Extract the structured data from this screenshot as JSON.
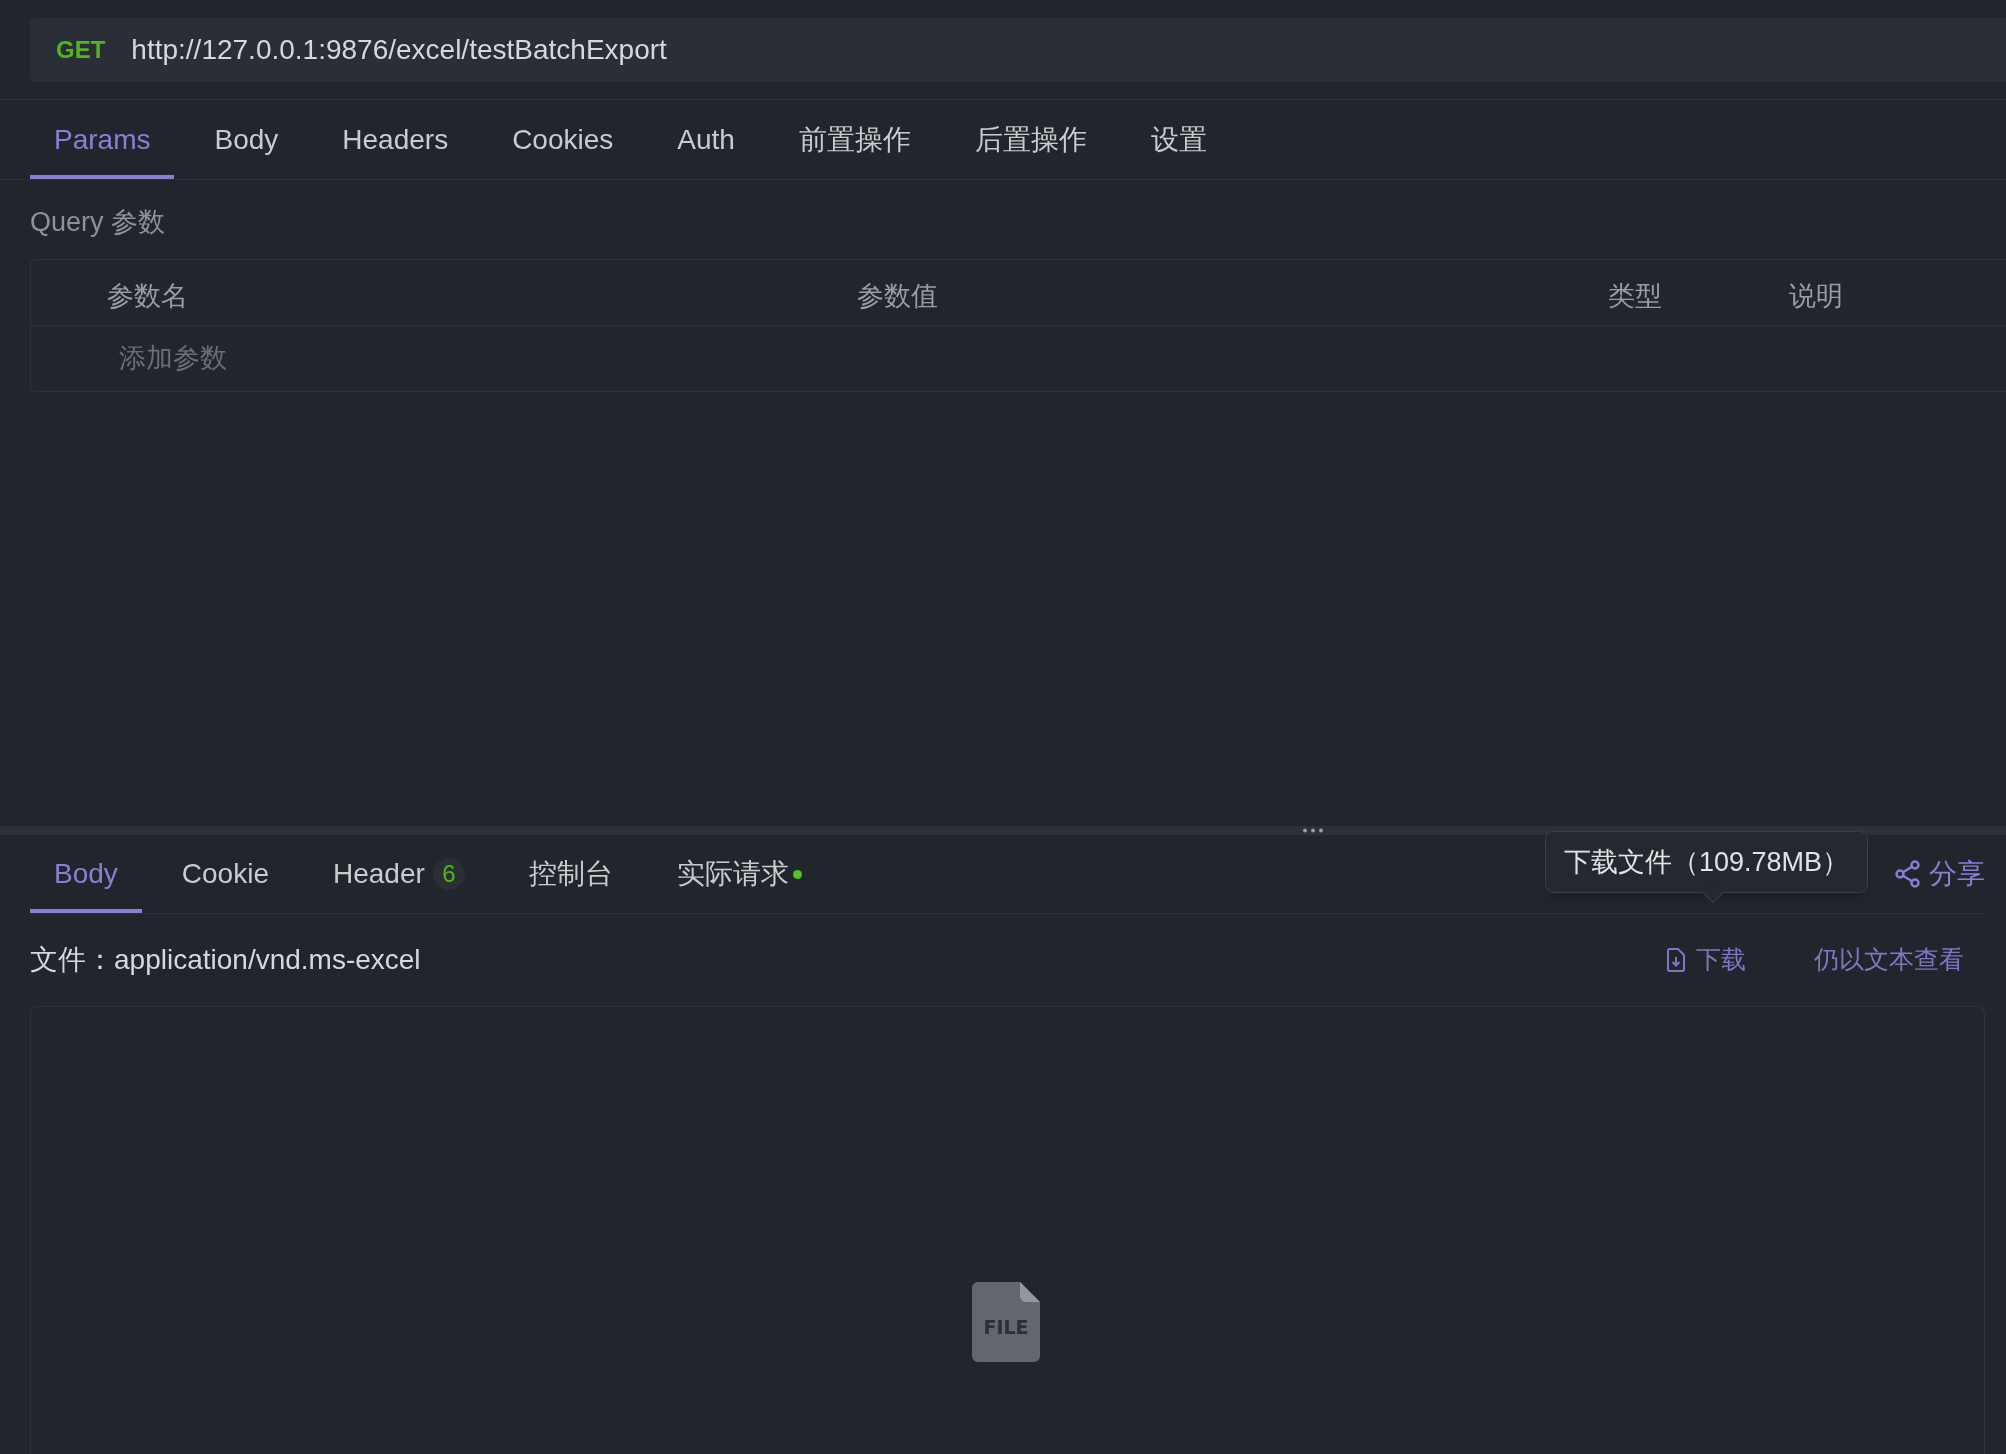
{
  "request": {
    "method": "GET",
    "url": "http://127.0.0.1:9876/excel/testBatchExport"
  },
  "request_tabs": [
    {
      "label": "Params",
      "selected": true
    },
    {
      "label": "Body",
      "selected": false
    },
    {
      "label": "Headers",
      "selected": false
    },
    {
      "label": "Cookies",
      "selected": false
    },
    {
      "label": "Auth",
      "selected": false
    },
    {
      "label": "前置操作",
      "selected": false
    },
    {
      "label": "后置操作",
      "selected": false
    },
    {
      "label": "设置",
      "selected": false
    }
  ],
  "query_label": "Query 参数",
  "params_table": {
    "columns": [
      "参数名",
      "参数值",
      "类型",
      "说明"
    ],
    "placeholder": "添加参数"
  },
  "response_tabs": [
    {
      "label": "Body",
      "selected": true,
      "dot": false
    },
    {
      "label": "Cookie",
      "selected": false,
      "dot": false
    },
    {
      "label": "Header",
      "selected": false,
      "badge": "6",
      "dot": false
    },
    {
      "label": "控制台",
      "selected": false,
      "dot": false
    },
    {
      "label": "实际请求",
      "selected": false,
      "dot": true
    }
  ],
  "tooltip": "下载文件（109.78MB）",
  "share": "分享",
  "file_info": {
    "label": "文件：",
    "mime": "application/vnd.ms-excel"
  },
  "actions": {
    "download": "下载",
    "view_as_text": "仍以文本查看"
  },
  "file_preview": {
    "icon_text": "FILE"
  }
}
